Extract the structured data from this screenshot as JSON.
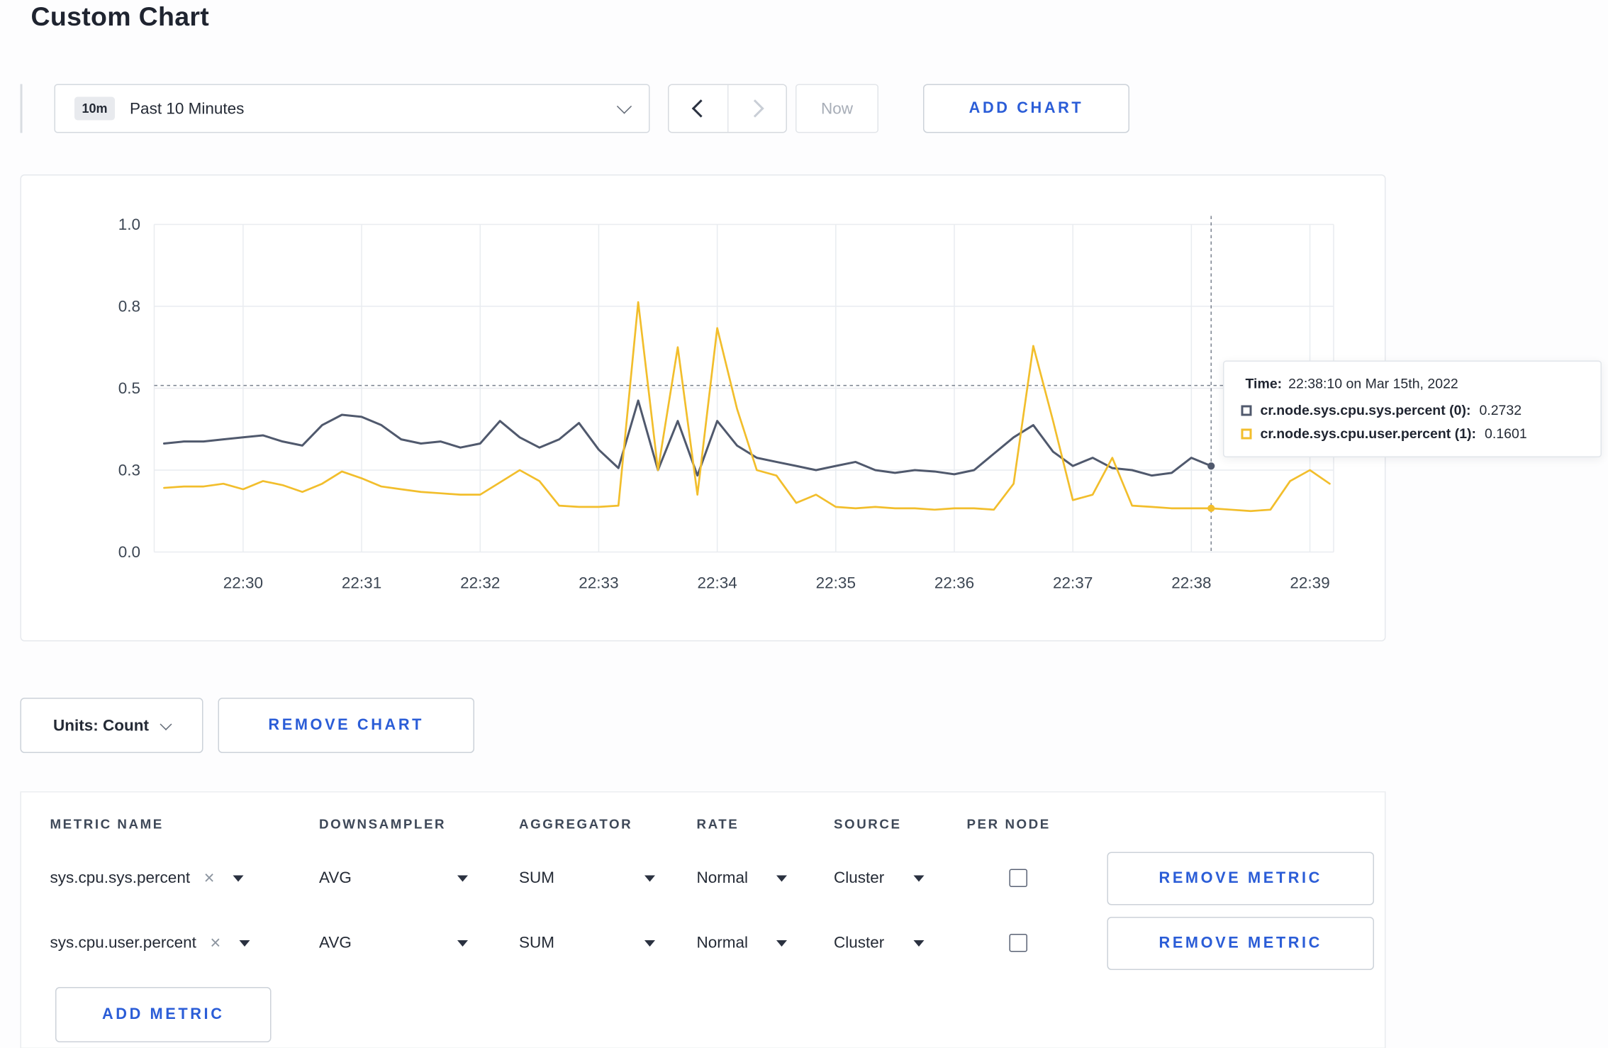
{
  "page": {
    "title": "Custom Chart"
  },
  "icons": {
    "clear": "×"
  },
  "toolbar": {
    "range_badge": "10m",
    "range_label": "Past 10 Minutes",
    "now_label": "Now",
    "add_chart_label": "ADD CHART"
  },
  "chart": {
    "tooltip": {
      "time_label": "Time:",
      "time_value": "22:38:10 on Mar 15th, 2022",
      "rows": [
        {
          "label": "cr.node.sys.cpu.sys.percent (0):",
          "value": "0.2732"
        },
        {
          "label": "cr.node.sys.cpu.user.percent (1):",
          "value": "0.1601"
        }
      ]
    }
  },
  "chart_data": {
    "type": "line",
    "title": "",
    "xlabel": "",
    "ylabel": "",
    "x_tick_labels": [
      "22:30",
      "22:31",
      "22:32",
      "22:33",
      "22:34",
      "22:35",
      "22:36",
      "22:37",
      "22:38",
      "22:39"
    ],
    "x_tick_minutes": [
      30,
      31,
      32,
      33,
      34,
      35,
      36,
      37,
      38,
      39
    ],
    "x_domain_minutes": [
      29.25,
      39.2
    ],
    "y_tick_labels": [
      "0.0",
      "0.3",
      "0.5",
      "0.8",
      "1.0"
    ],
    "y_tick_values": [
      0.0,
      0.3,
      0.5,
      0.8,
      1.0
    ],
    "grid": true,
    "sample_interval_sec": 10,
    "series": [
      {
        "name": "cr.node.sys.cpu.sys.percent",
        "color": "#50596d",
        "start_minute": 29.3333,
        "values": [
          0.365,
          0.37,
          0.37,
          0.375,
          0.38,
          0.385,
          0.37,
          0.36,
          0.41,
          0.435,
          0.43,
          0.41,
          0.375,
          0.365,
          0.37,
          0.355,
          0.365,
          0.42,
          0.38,
          0.355,
          0.375,
          0.415,
          0.35,
          0.305,
          0.47,
          0.3,
          0.42,
          0.28,
          0.42,
          0.36,
          0.33,
          0.32,
          0.31,
          0.3,
          0.31,
          0.32,
          0.3,
          0.29,
          0.3,
          0.295,
          0.285,
          0.3,
          0.34,
          0.38,
          0.41,
          0.345,
          0.31,
          0.33,
          0.305,
          0.3,
          0.28,
          0.29,
          0.33,
          0.31
        ]
      },
      {
        "name": "cr.node.sys.cpu.user.percent",
        "color": "#f2be2c",
        "start_minute": 29.3333,
        "values": [
          0.235,
          0.24,
          0.24,
          0.25,
          0.23,
          0.26,
          0.245,
          0.22,
          0.25,
          0.295,
          0.27,
          0.24,
          0.23,
          0.22,
          0.215,
          0.21,
          0.21,
          0.255,
          0.3,
          0.26,
          0.17,
          0.165,
          0.165,
          0.17,
          0.81,
          0.3,
          0.65,
          0.21,
          0.72,
          0.45,
          0.3,
          0.28,
          0.18,
          0.21,
          0.165,
          0.16,
          0.165,
          0.16,
          0.16,
          0.155,
          0.16,
          0.16,
          0.155,
          0.25,
          0.655,
          0.42,
          0.19,
          0.21,
          0.33,
          0.17,
          0.165,
          0.16,
          0.16,
          0.16,
          0.155,
          0.15,
          0.155,
          0.26,
          0.3,
          0.25
        ]
      }
    ],
    "crosshair": {
      "time_minute": 38.1667,
      "time_label": "22:38:10",
      "hline_value": 0.51,
      "dots": [
        {
          "series": 0,
          "value": 0.31
        },
        {
          "series": 1,
          "value": 0.16
        }
      ]
    }
  },
  "units_bar": {
    "units_label": "Units: Count",
    "remove_chart_label": "REMOVE CHART"
  },
  "metrics_table": {
    "headers": {
      "metric": "METRIC NAME",
      "downsampler": "DOWNSAMPLER",
      "aggregator": "AGGREGATOR",
      "rate": "RATE",
      "source": "SOURCE",
      "per_node": "PER NODE"
    },
    "rows": [
      {
        "metric": "sys.cpu.sys.percent",
        "downsampler": "AVG",
        "aggregator": "SUM",
        "rate": "Normal",
        "source": "Cluster",
        "per_node_checked": false,
        "remove_label": "REMOVE METRIC"
      },
      {
        "metric": "sys.cpu.user.percent",
        "downsampler": "AVG",
        "aggregator": "SUM",
        "rate": "Normal",
        "source": "Cluster",
        "per_node_checked": false,
        "remove_label": "REMOVE METRIC"
      }
    ],
    "add_metric_label": "ADD METRIC"
  }
}
